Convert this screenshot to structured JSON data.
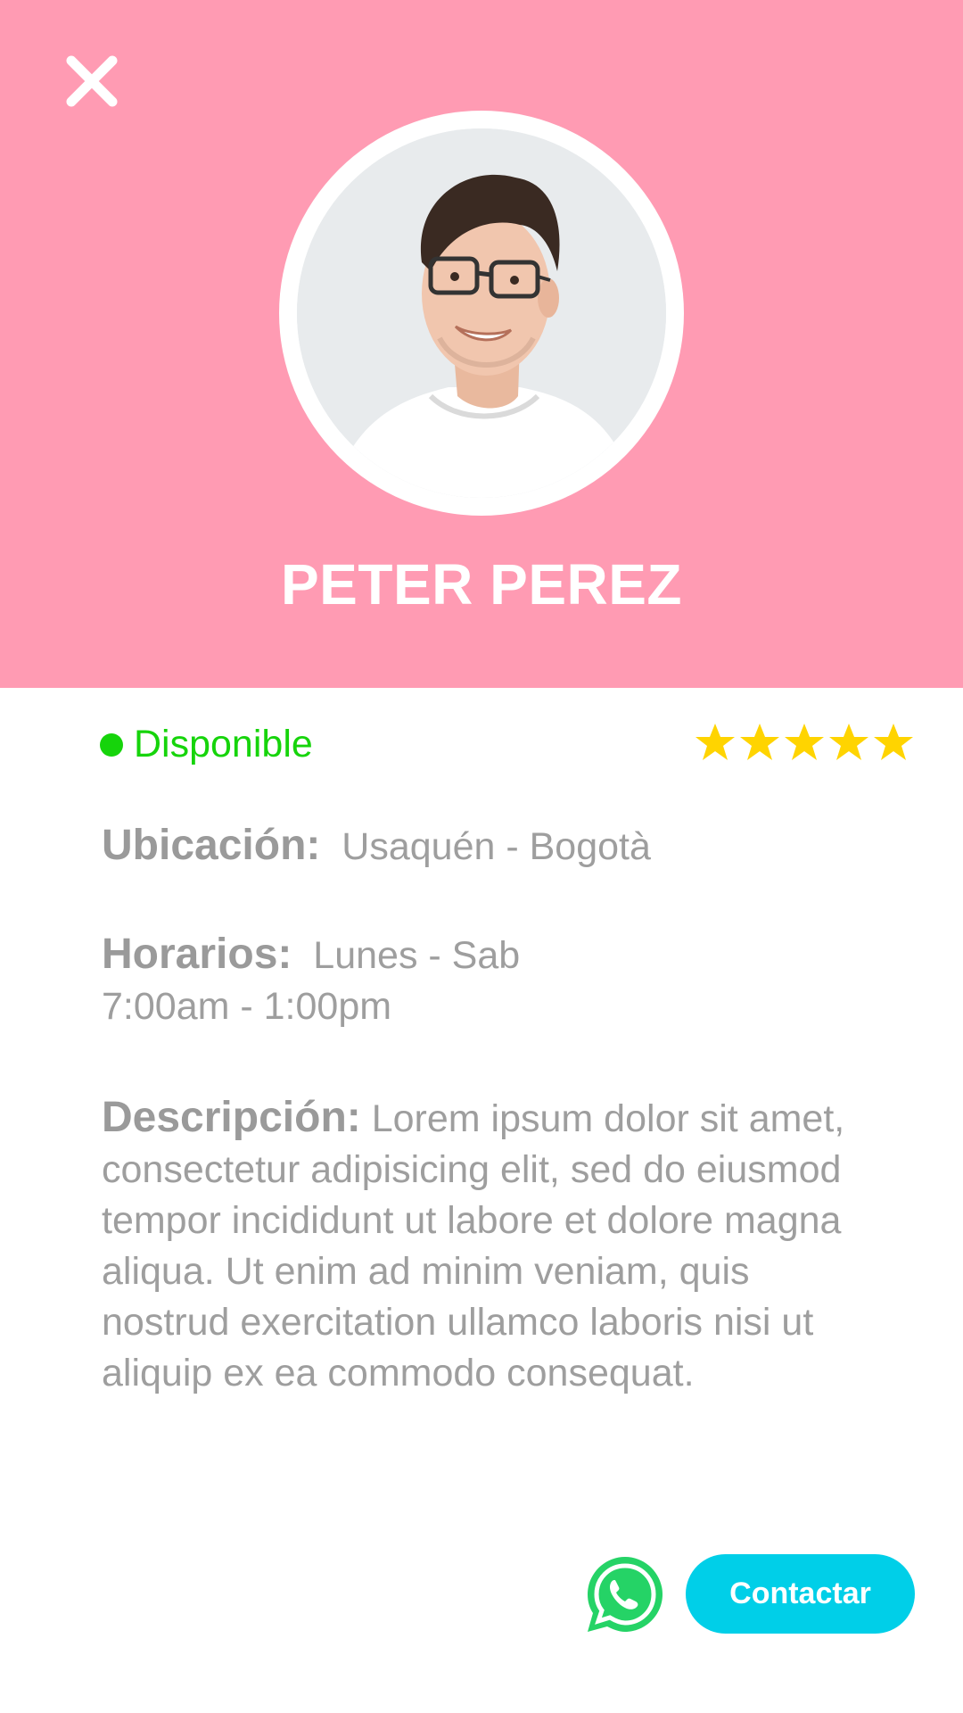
{
  "header": {
    "background_color": "#FF9BB3",
    "close_icon": "close-icon",
    "name": "PETER PEREZ"
  },
  "status": {
    "label": "Disponible",
    "color": "#16D40B"
  },
  "rating": {
    "stars": 5,
    "max": 5,
    "color": "#FFD400"
  },
  "location": {
    "label": "Ubicación:",
    "value": "Usaquén - Bogotà"
  },
  "hours": {
    "label": "Horarios:",
    "days": "Lunes - Sab",
    "time": "7:00am - 1:00pm"
  },
  "description": {
    "label": "Descripción:",
    "text": "Lorem ipsum dolor sit amet, consectetur adipisicing elit, sed do eiusmod tempor incididunt ut labore et dolore magna aliqua. Ut enim ad minim veniam, quis nostrud exercitation ullamco laboris nisi ut aliquip ex ea commodo consequat."
  },
  "actions": {
    "whatsapp_icon": "whatsapp-icon",
    "whatsapp_color": "#25D366",
    "contact_label": "Contactar",
    "contact_color": "#00CFE8"
  }
}
